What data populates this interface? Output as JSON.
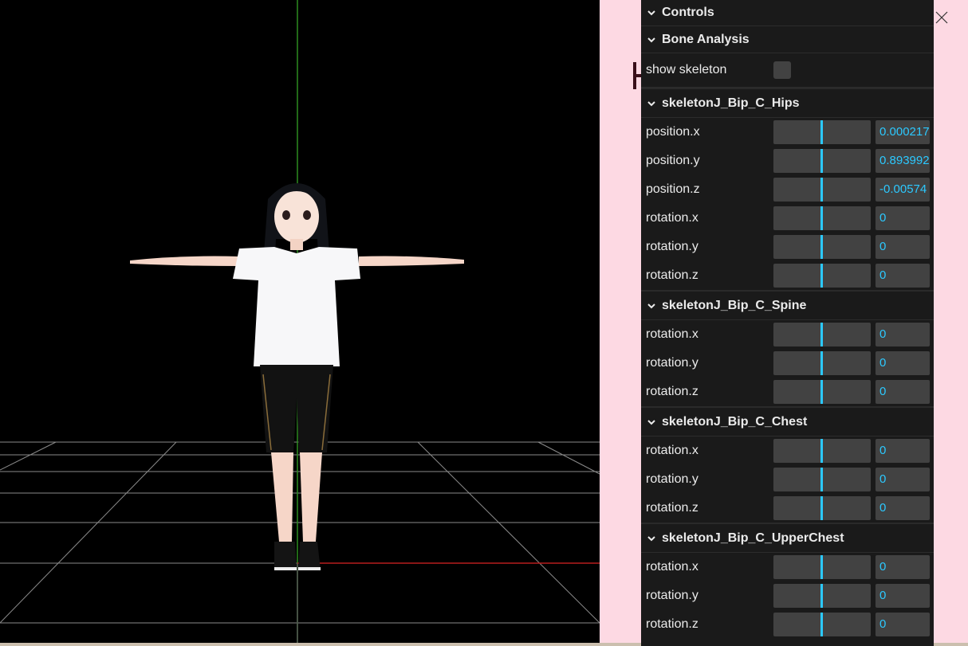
{
  "window": {
    "minimize_icon": "minimize-icon",
    "maximize_icon": "maximize-icon",
    "close_icon": "close-icon"
  },
  "colors": {
    "accent": "#2cc9ff",
    "panel_bg": "#1a1a1a",
    "field_bg": "#424242",
    "window_bg": "#fdd9e3"
  },
  "panel": {
    "title": "Controls",
    "folder": "Bone Analysis",
    "show_skeleton_label": "show skeleton",
    "show_skeleton_checked": false,
    "bones": [
      {
        "name": "skeletonJ_Bip_C_Hips",
        "props": [
          {
            "label": "position.x",
            "value": "0.000217"
          },
          {
            "label": "position.y",
            "value": "0.893992"
          },
          {
            "label": "position.z",
            "value": "-0.00574"
          },
          {
            "label": "rotation.x",
            "value": "0"
          },
          {
            "label": "rotation.y",
            "value": "0"
          },
          {
            "label": "rotation.z",
            "value": "0"
          }
        ]
      },
      {
        "name": "skeletonJ_Bip_C_Spine",
        "props": [
          {
            "label": "rotation.x",
            "value": "0"
          },
          {
            "label": "rotation.y",
            "value": "0"
          },
          {
            "label": "rotation.z",
            "value": "0"
          }
        ]
      },
      {
        "name": "skeletonJ_Bip_C_Chest",
        "props": [
          {
            "label": "rotation.x",
            "value": "0"
          },
          {
            "label": "rotation.y",
            "value": "0"
          },
          {
            "label": "rotation.z",
            "value": "0"
          }
        ]
      },
      {
        "name": "skeletonJ_Bip_C_UpperChest",
        "props": [
          {
            "label": "rotation.x",
            "value": "0"
          },
          {
            "label": "rotation.y",
            "value": "0"
          },
          {
            "label": "rotation.z",
            "value": "0"
          }
        ]
      }
    ]
  }
}
